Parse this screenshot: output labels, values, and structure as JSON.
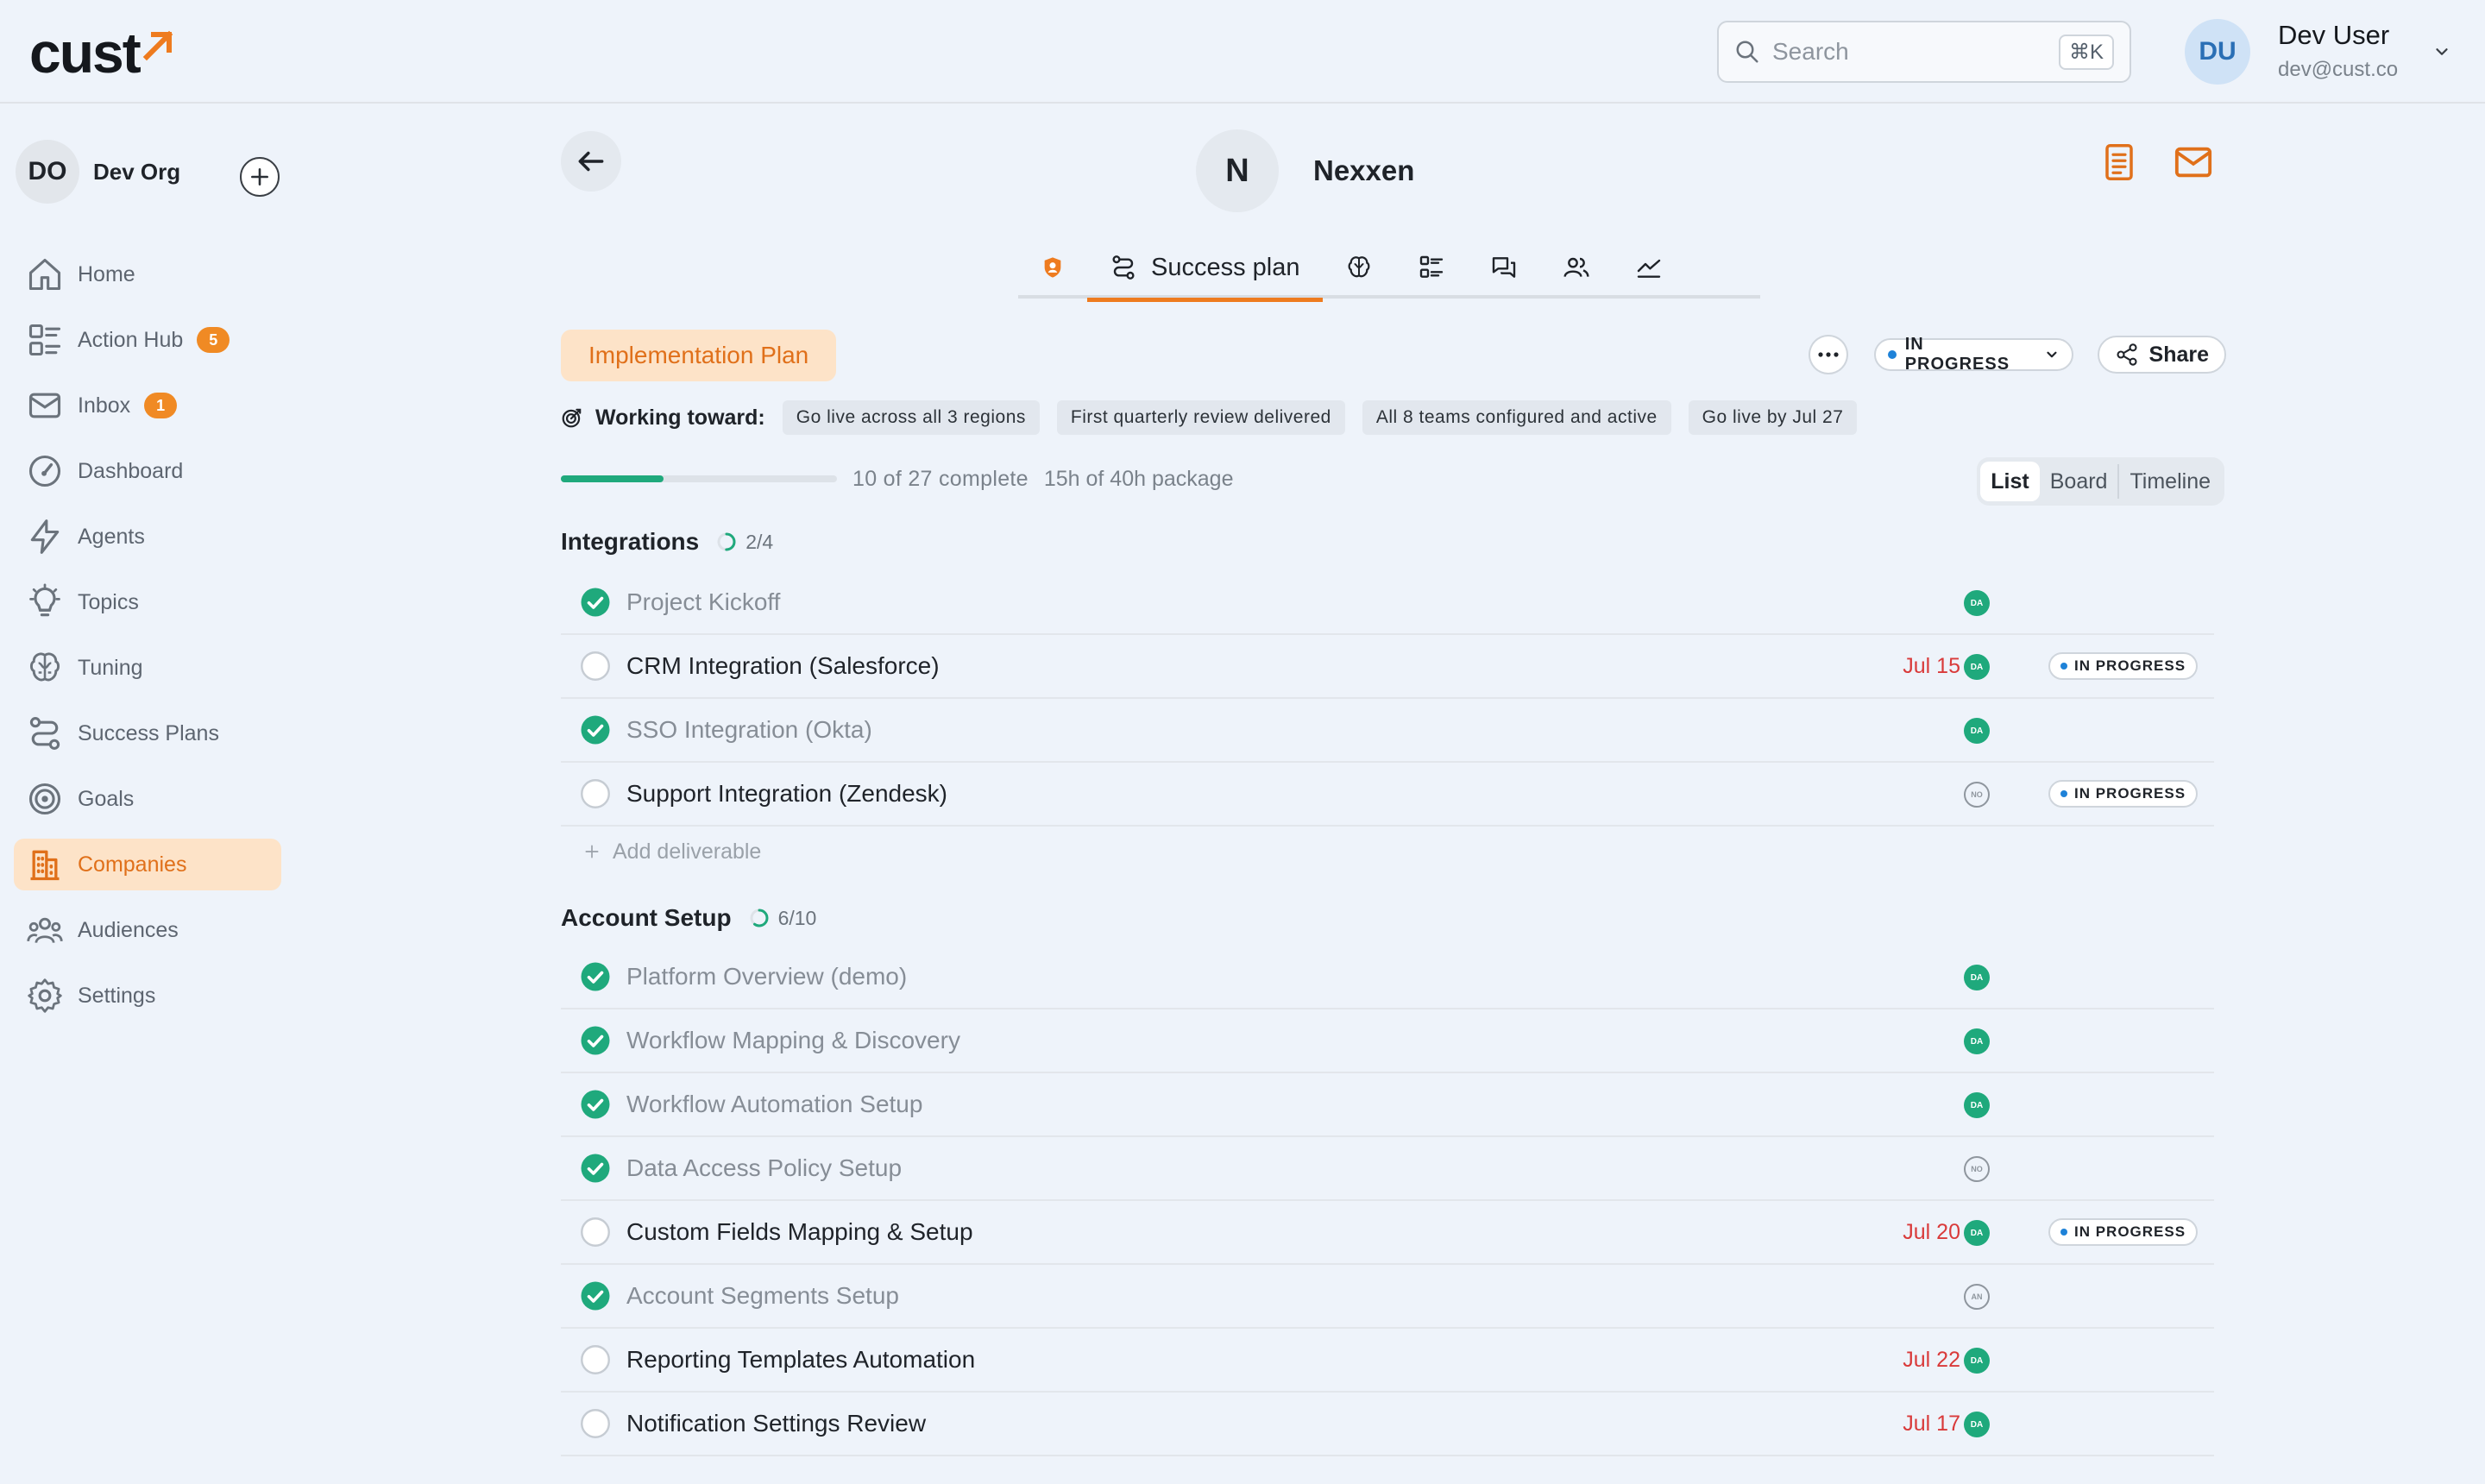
{
  "header": {
    "logo_text": "cust",
    "search_placeholder": "Search",
    "search_shortcut": "⌘K",
    "user": {
      "initials": "DU",
      "name": "Dev User",
      "email": "dev@cust.co"
    }
  },
  "sidebar": {
    "org": {
      "initials": "DO",
      "name": "Dev Org"
    },
    "items": [
      {
        "label": "Home",
        "icon": "home-icon"
      },
      {
        "label": "Action Hub",
        "icon": "action-hub-icon",
        "badge": "5"
      },
      {
        "label": "Inbox",
        "icon": "mail-icon",
        "badge": "1"
      },
      {
        "label": "Dashboard",
        "icon": "dashboard-icon"
      },
      {
        "label": "Agents",
        "icon": "lightning-icon"
      },
      {
        "label": "Topics",
        "icon": "lightbulb-icon"
      },
      {
        "label": "Tuning",
        "icon": "brain-icon"
      },
      {
        "label": "Success Plans",
        "icon": "route-icon"
      },
      {
        "label": "Goals",
        "icon": "target-icon"
      },
      {
        "label": "Companies",
        "icon": "building-icon",
        "active": true
      },
      {
        "label": "Audiences",
        "icon": "users-icon"
      },
      {
        "label": "Settings",
        "icon": "gear-icon"
      }
    ]
  },
  "company": {
    "initial": "N",
    "name": "Nexxen"
  },
  "tabs": [
    {
      "icon": "company-badge-icon"
    },
    {
      "icon": "route-icon",
      "label": "Success plan",
      "active": true
    },
    {
      "icon": "brain-icon"
    },
    {
      "icon": "list-icon"
    },
    {
      "icon": "chat-icon"
    },
    {
      "icon": "users-icon"
    },
    {
      "icon": "chart-icon"
    }
  ],
  "plan": {
    "title": "Implementation Plan",
    "status": "IN PROGRESS",
    "share_label": "Share",
    "working_toward_label": "Working toward:",
    "goals": [
      "Go live across all 3 regions",
      "First quarterly review delivered",
      "All 8 teams configured and active",
      "Go live by Jul 27"
    ],
    "progress": {
      "completed": 10,
      "total": 27,
      "text": "10 of 27 complete",
      "hours_text": "15h of 40h package"
    },
    "views": [
      "List",
      "Board",
      "Timeline"
    ],
    "active_view": "List"
  },
  "sections": [
    {
      "title": "Integrations",
      "count": "2/4",
      "progress": 0.5,
      "add_label": "Add deliverable",
      "rows": [
        {
          "title": "Project Kickoff",
          "done": true,
          "assignee": "DA",
          "assignee_style": "filled"
        },
        {
          "title": "CRM Integration (Salesforce)",
          "done": false,
          "due": "Jul 15",
          "assignee": "DA",
          "assignee_style": "filled",
          "status": "IN PROGRESS"
        },
        {
          "title": "SSO Integration (Okta)",
          "done": true,
          "assignee": "DA",
          "assignee_style": "filled"
        },
        {
          "title": "Support Integration (Zendesk)",
          "done": false,
          "assignee": "NO",
          "assignee_style": "outline",
          "status": "IN PROGRESS"
        }
      ]
    },
    {
      "title": "Account Setup",
      "count": "6/10",
      "progress": 0.6,
      "rows": [
        {
          "title": "Platform Overview (demo)",
          "done": true,
          "assignee": "DA",
          "assignee_style": "filled"
        },
        {
          "title": "Workflow Mapping & Discovery",
          "done": true,
          "assignee": "DA",
          "assignee_style": "filled"
        },
        {
          "title": "Workflow Automation Setup",
          "done": true,
          "assignee": "DA",
          "assignee_style": "filled"
        },
        {
          "title": "Data Access Policy Setup",
          "done": true,
          "assignee": "NO",
          "assignee_style": "outline"
        },
        {
          "title": "Custom Fields Mapping & Setup",
          "done": false,
          "due": "Jul 20",
          "assignee": "DA",
          "assignee_style": "filled",
          "status": "IN PROGRESS"
        },
        {
          "title": "Account Segments Setup",
          "done": true,
          "assignee": "AN",
          "assignee_style": "outline"
        },
        {
          "title": "Reporting Templates Automation",
          "done": false,
          "due": "Jul 22",
          "assignee": "DA",
          "assignee_style": "filled"
        },
        {
          "title": "Notification Settings Review",
          "done": false,
          "due": "Jul 17",
          "assignee": "DA",
          "assignee_style": "filled"
        }
      ]
    }
  ],
  "colors": {
    "accent": "#ee7b1f",
    "success": "#1fa97c",
    "due": "#d93a3a",
    "status_dot": "#1e82d8",
    "background": "#eef3fa"
  }
}
